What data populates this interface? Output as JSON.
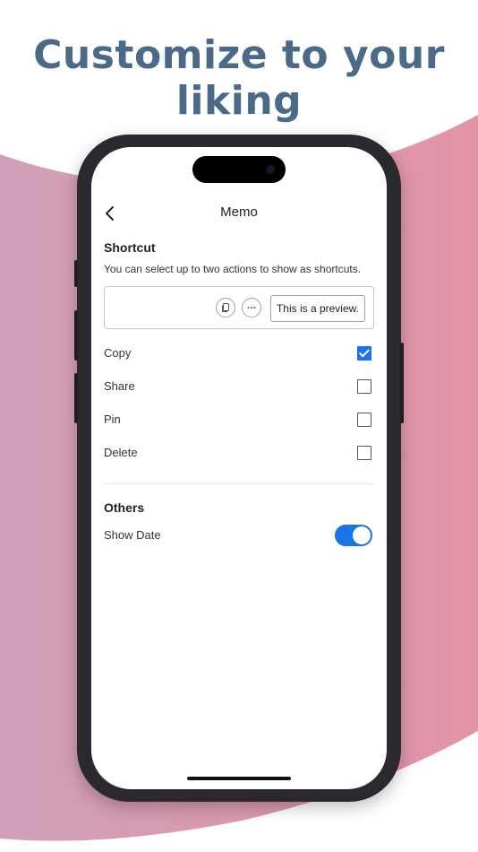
{
  "headline": "Customize to your liking",
  "colors": {
    "headline": "#4a6a88",
    "wave_left": "#cfa0b8",
    "wave_right": "#e493a6",
    "accent": "#1a73e8"
  },
  "nav": {
    "title": "Memo",
    "back_icon": "chevron-left-icon"
  },
  "shortcut": {
    "title": "Shortcut",
    "description": "You can select up to two actions to show as shortcuts.",
    "preview": {
      "icons": [
        "copy-icon",
        "more-icon"
      ],
      "text": "This is a preview."
    },
    "options": [
      {
        "label": "Copy",
        "checked": true
      },
      {
        "label": "Share",
        "checked": false
      },
      {
        "label": "Pin",
        "checked": false
      },
      {
        "label": "Delete",
        "checked": false
      }
    ]
  },
  "others": {
    "title": "Others",
    "show_date": {
      "label": "Show Date",
      "enabled": true
    }
  }
}
